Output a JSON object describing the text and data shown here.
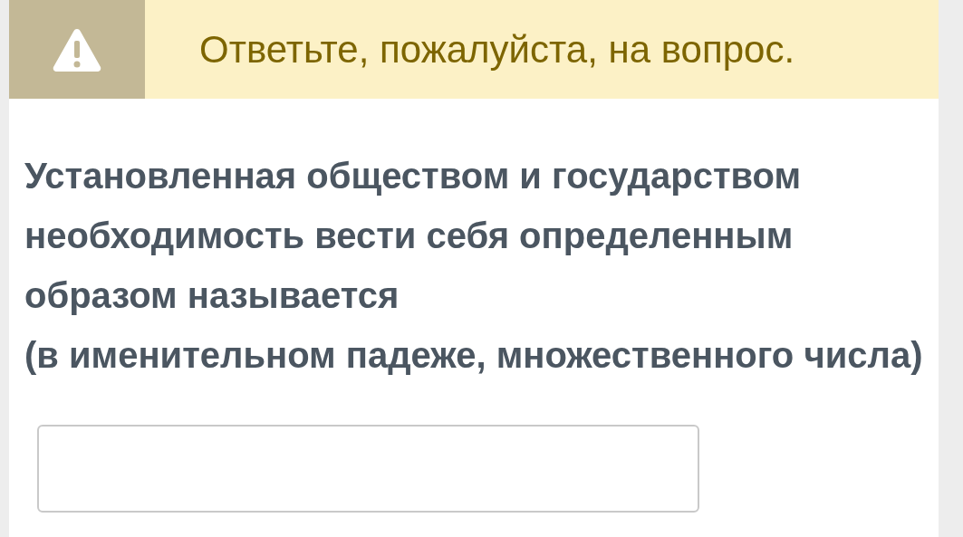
{
  "alert": {
    "message": "Ответьте, пожалуйста, на вопрос."
  },
  "question": {
    "text": "Установленная обществом и государством необходимость вести себя определенным образом называется",
    "hint": "(в именительном падеже, множественного числа)"
  }
}
